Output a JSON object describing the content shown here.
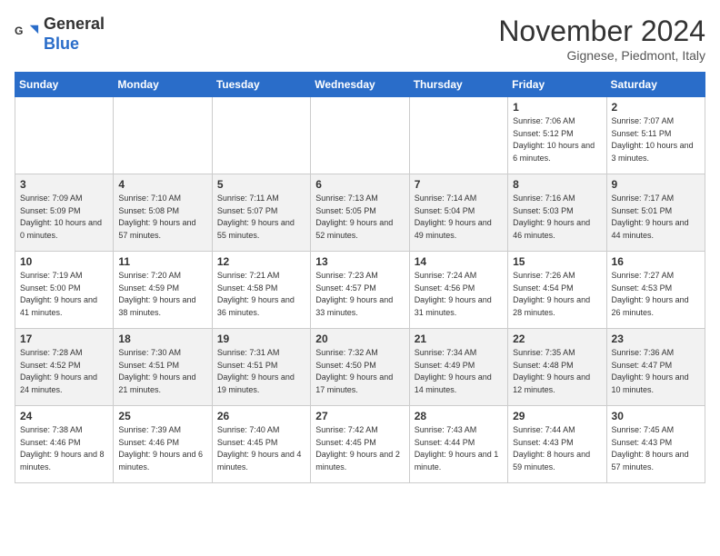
{
  "header": {
    "logo_line1": "General",
    "logo_line2": "Blue",
    "month": "November 2024",
    "location": "Gignese, Piedmont, Italy"
  },
  "days_of_week": [
    "Sunday",
    "Monday",
    "Tuesday",
    "Wednesday",
    "Thursday",
    "Friday",
    "Saturday"
  ],
  "weeks": [
    [
      {
        "day": "",
        "info": ""
      },
      {
        "day": "",
        "info": ""
      },
      {
        "day": "",
        "info": ""
      },
      {
        "day": "",
        "info": ""
      },
      {
        "day": "",
        "info": ""
      },
      {
        "day": "1",
        "info": "Sunrise: 7:06 AM\nSunset: 5:12 PM\nDaylight: 10 hours and 6 minutes."
      },
      {
        "day": "2",
        "info": "Sunrise: 7:07 AM\nSunset: 5:11 PM\nDaylight: 10 hours and 3 minutes."
      }
    ],
    [
      {
        "day": "3",
        "info": "Sunrise: 7:09 AM\nSunset: 5:09 PM\nDaylight: 10 hours and 0 minutes."
      },
      {
        "day": "4",
        "info": "Sunrise: 7:10 AM\nSunset: 5:08 PM\nDaylight: 9 hours and 57 minutes."
      },
      {
        "day": "5",
        "info": "Sunrise: 7:11 AM\nSunset: 5:07 PM\nDaylight: 9 hours and 55 minutes."
      },
      {
        "day": "6",
        "info": "Sunrise: 7:13 AM\nSunset: 5:05 PM\nDaylight: 9 hours and 52 minutes."
      },
      {
        "day": "7",
        "info": "Sunrise: 7:14 AM\nSunset: 5:04 PM\nDaylight: 9 hours and 49 minutes."
      },
      {
        "day": "8",
        "info": "Sunrise: 7:16 AM\nSunset: 5:03 PM\nDaylight: 9 hours and 46 minutes."
      },
      {
        "day": "9",
        "info": "Sunrise: 7:17 AM\nSunset: 5:01 PM\nDaylight: 9 hours and 44 minutes."
      }
    ],
    [
      {
        "day": "10",
        "info": "Sunrise: 7:19 AM\nSunset: 5:00 PM\nDaylight: 9 hours and 41 minutes."
      },
      {
        "day": "11",
        "info": "Sunrise: 7:20 AM\nSunset: 4:59 PM\nDaylight: 9 hours and 38 minutes."
      },
      {
        "day": "12",
        "info": "Sunrise: 7:21 AM\nSunset: 4:58 PM\nDaylight: 9 hours and 36 minutes."
      },
      {
        "day": "13",
        "info": "Sunrise: 7:23 AM\nSunset: 4:57 PM\nDaylight: 9 hours and 33 minutes."
      },
      {
        "day": "14",
        "info": "Sunrise: 7:24 AM\nSunset: 4:56 PM\nDaylight: 9 hours and 31 minutes."
      },
      {
        "day": "15",
        "info": "Sunrise: 7:26 AM\nSunset: 4:54 PM\nDaylight: 9 hours and 28 minutes."
      },
      {
        "day": "16",
        "info": "Sunrise: 7:27 AM\nSunset: 4:53 PM\nDaylight: 9 hours and 26 minutes."
      }
    ],
    [
      {
        "day": "17",
        "info": "Sunrise: 7:28 AM\nSunset: 4:52 PM\nDaylight: 9 hours and 24 minutes."
      },
      {
        "day": "18",
        "info": "Sunrise: 7:30 AM\nSunset: 4:51 PM\nDaylight: 9 hours and 21 minutes."
      },
      {
        "day": "19",
        "info": "Sunrise: 7:31 AM\nSunset: 4:51 PM\nDaylight: 9 hours and 19 minutes."
      },
      {
        "day": "20",
        "info": "Sunrise: 7:32 AM\nSunset: 4:50 PM\nDaylight: 9 hours and 17 minutes."
      },
      {
        "day": "21",
        "info": "Sunrise: 7:34 AM\nSunset: 4:49 PM\nDaylight: 9 hours and 14 minutes."
      },
      {
        "day": "22",
        "info": "Sunrise: 7:35 AM\nSunset: 4:48 PM\nDaylight: 9 hours and 12 minutes."
      },
      {
        "day": "23",
        "info": "Sunrise: 7:36 AM\nSunset: 4:47 PM\nDaylight: 9 hours and 10 minutes."
      }
    ],
    [
      {
        "day": "24",
        "info": "Sunrise: 7:38 AM\nSunset: 4:46 PM\nDaylight: 9 hours and 8 minutes."
      },
      {
        "day": "25",
        "info": "Sunrise: 7:39 AM\nSunset: 4:46 PM\nDaylight: 9 hours and 6 minutes."
      },
      {
        "day": "26",
        "info": "Sunrise: 7:40 AM\nSunset: 4:45 PM\nDaylight: 9 hours and 4 minutes."
      },
      {
        "day": "27",
        "info": "Sunrise: 7:42 AM\nSunset: 4:45 PM\nDaylight: 9 hours and 2 minutes."
      },
      {
        "day": "28",
        "info": "Sunrise: 7:43 AM\nSunset: 4:44 PM\nDaylight: 9 hours and 1 minute."
      },
      {
        "day": "29",
        "info": "Sunrise: 7:44 AM\nSunset: 4:43 PM\nDaylight: 8 hours and 59 minutes."
      },
      {
        "day": "30",
        "info": "Sunrise: 7:45 AM\nSunset: 4:43 PM\nDaylight: 8 hours and 57 minutes."
      }
    ]
  ]
}
